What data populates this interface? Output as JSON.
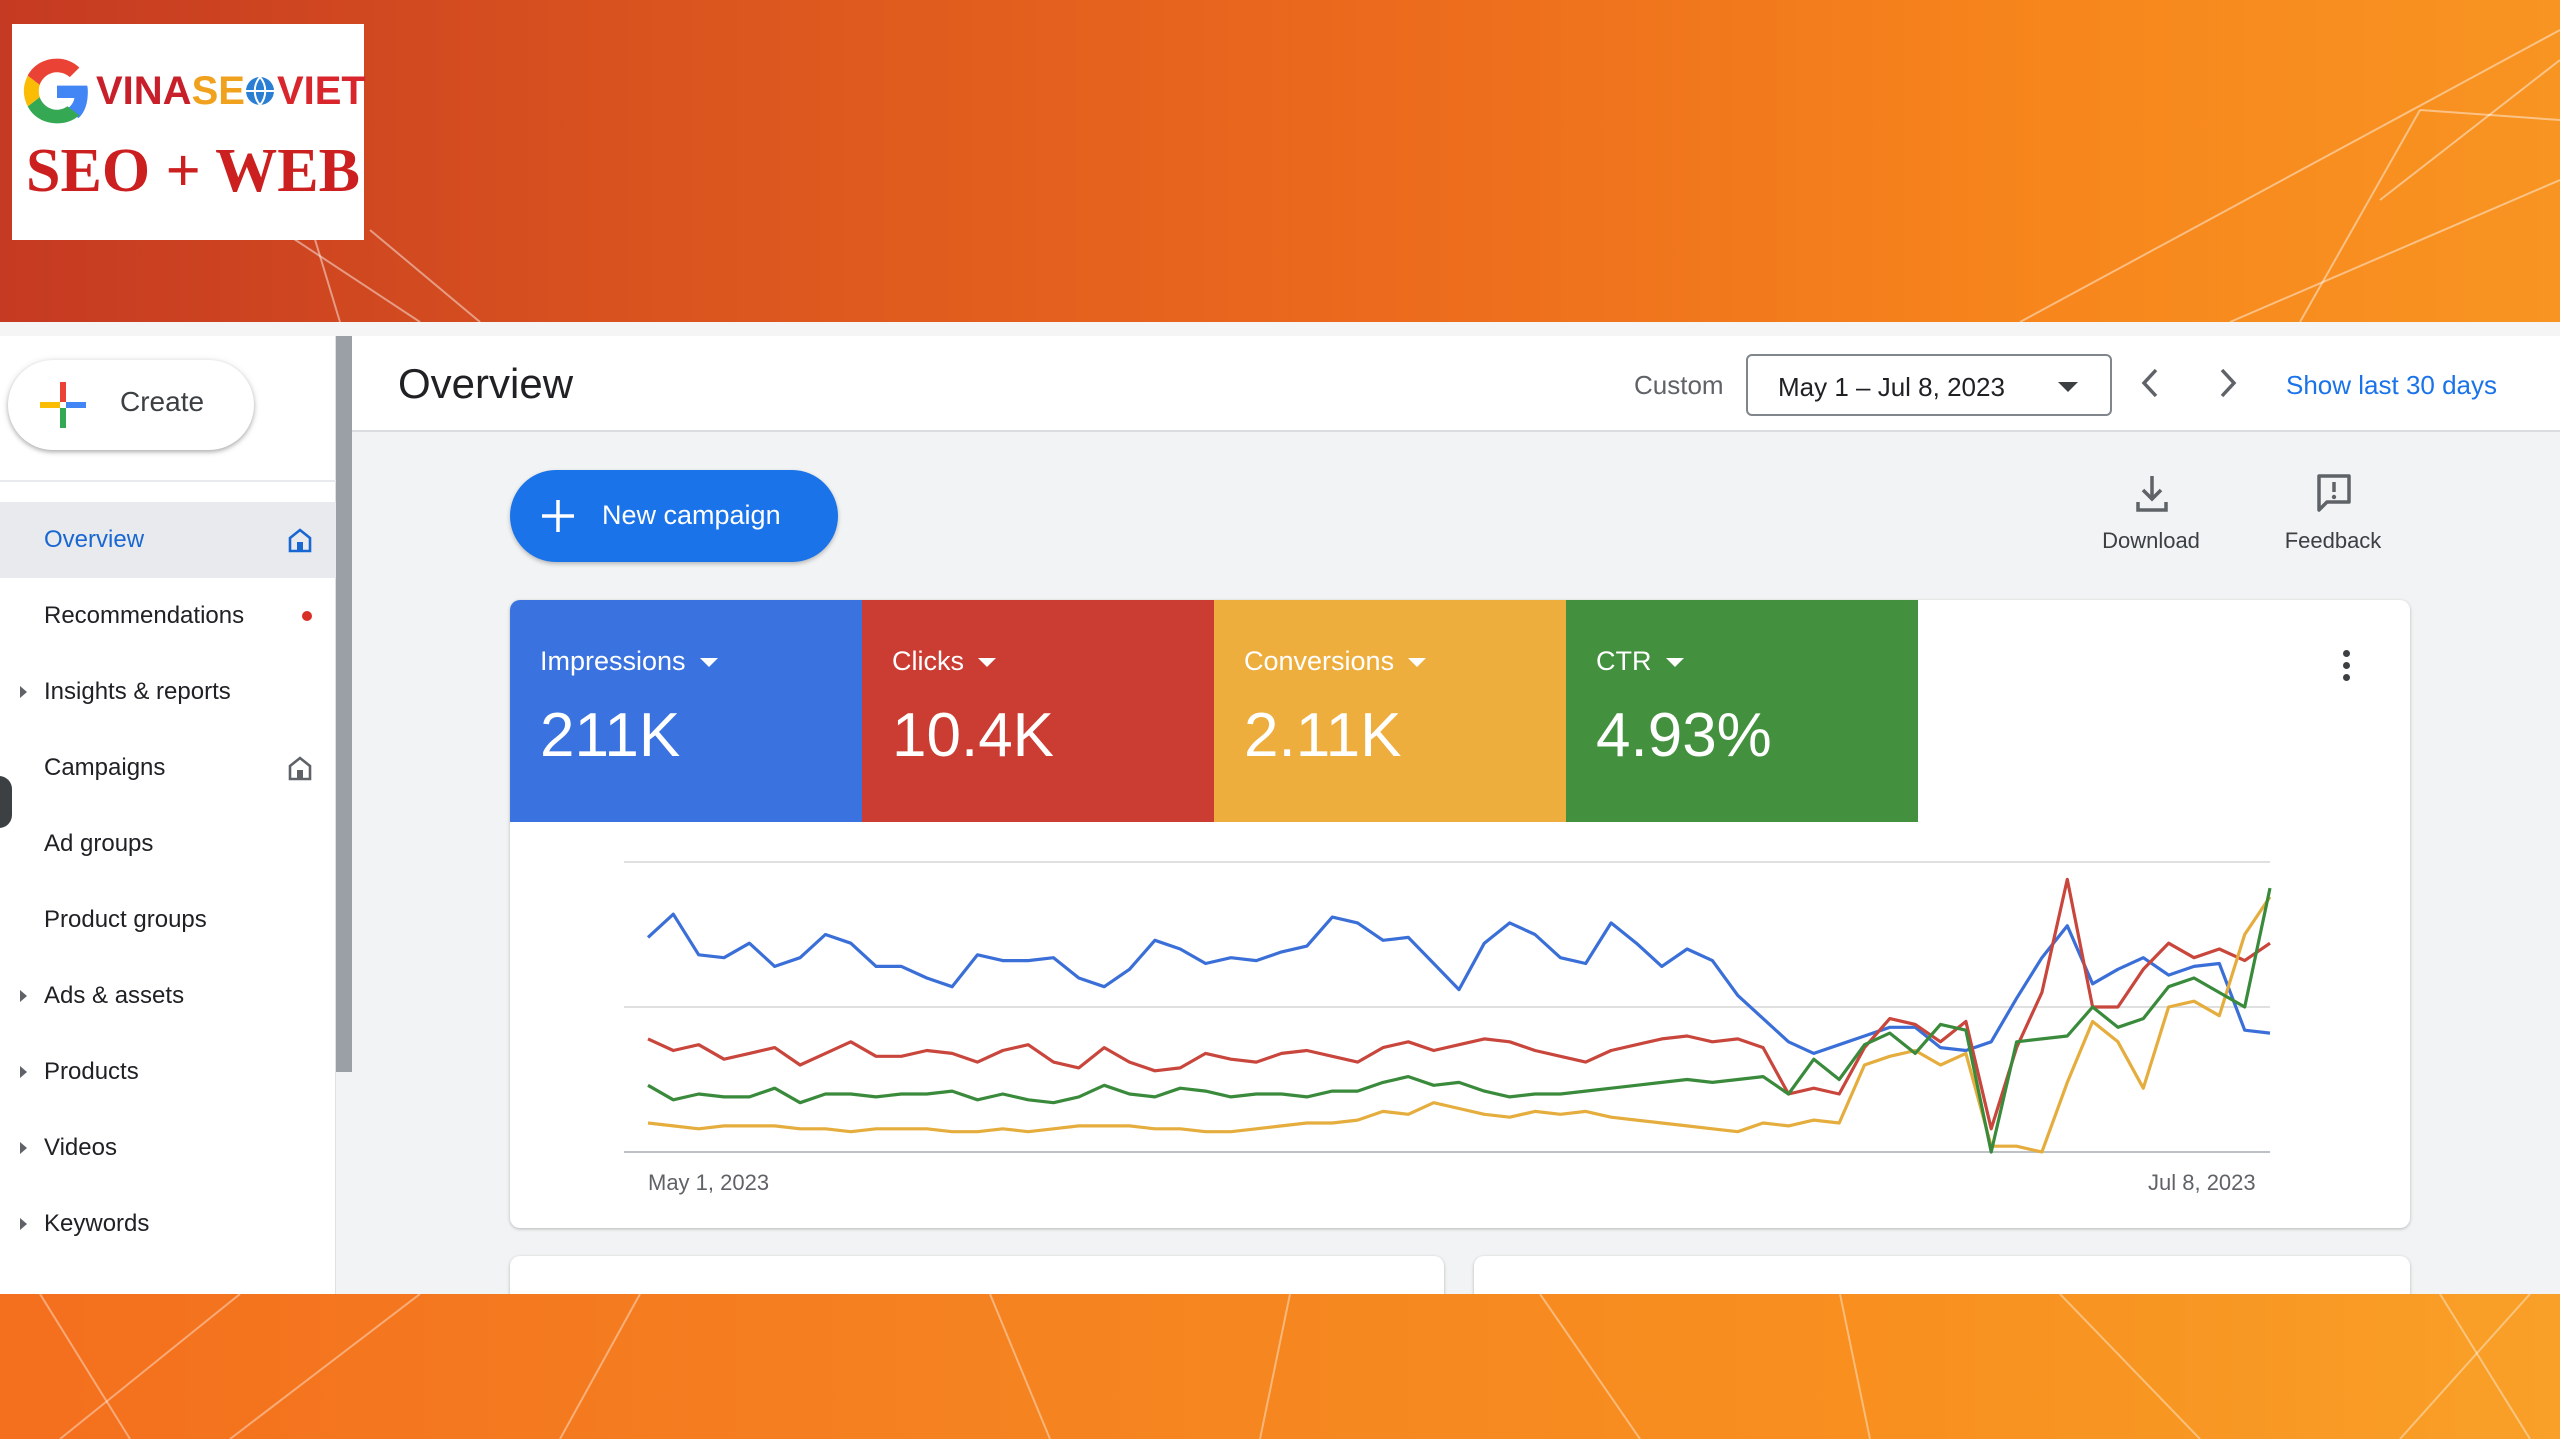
{
  "logo": {
    "brand_parts": [
      "VINA",
      "SE",
      "VIET"
    ],
    "tagline": "SEO + WEB",
    "colors": {
      "red": "#c8202a",
      "gold": "#f0a21e"
    }
  },
  "sidebar": {
    "create_label": "Create",
    "items": [
      {
        "label": "Overview",
        "active": true,
        "icon": "home-icon"
      },
      {
        "label": "Recommendations",
        "badge": "red-dot"
      },
      {
        "label": "Insights & reports",
        "expandable": true
      },
      {
        "label": "Campaigns",
        "icon": "home-icon"
      },
      {
        "label": "Ad groups"
      },
      {
        "label": "Product groups"
      },
      {
        "label": "Ads & assets",
        "expandable": true
      },
      {
        "label": "Products",
        "expandable": true
      },
      {
        "label": "Videos",
        "expandable": true
      },
      {
        "label": "Keywords",
        "expandable": true
      }
    ]
  },
  "header": {
    "title": "Overview",
    "range_mode": "Custom",
    "date_range": "May 1 – Jul 8, 2023",
    "show_last": "Show last 30 days"
  },
  "toolbar": {
    "new_campaign": "New campaign",
    "download": "Download",
    "feedback": "Feedback"
  },
  "metrics": [
    {
      "name": "Impressions",
      "value": "211K",
      "color": "#3a72df"
    },
    {
      "name": "Clicks",
      "value": "10.4K",
      "color": "#cb3c32"
    },
    {
      "name": "Conversions",
      "value": "2.11K",
      "color": "#eeae3d"
    },
    {
      "name": "CTR",
      "value": "4.93%",
      "color": "#43903f"
    }
  ],
  "chart_data": {
    "type": "line",
    "x_start_label": "May 1, 2023",
    "x_end_label": "Jul 8, 2023",
    "ylim": [
      0,
      100
    ],
    "grid": true,
    "series": [
      {
        "name": "Impressions",
        "color": "#3b6fd8",
        "values": [
          74,
          82,
          68,
          67,
          72,
          64,
          67,
          75,
          72,
          64,
          64,
          60,
          57,
          68,
          66,
          66,
          67,
          60,
          57,
          63,
          73,
          70,
          65,
          67,
          66,
          69,
          71,
          81,
          79,
          73,
          74,
          65,
          56,
          72,
          79,
          75,
          67,
          65,
          79,
          72,
          64,
          70,
          66,
          54,
          46,
          38,
          34,
          37,
          40,
          43,
          43,
          36,
          35,
          38,
          53,
          67,
          78,
          58,
          63,
          67,
          61,
          64,
          65,
          42,
          41
        ]
      },
      {
        "name": "Clicks",
        "color": "#c9463d",
        "values": [
          39,
          35,
          37,
          32,
          34,
          36,
          30,
          34,
          38,
          33,
          33,
          35,
          34,
          31,
          35,
          37,
          31,
          29,
          36,
          31,
          28,
          29,
          34,
          32,
          31,
          34,
          35,
          33,
          31,
          36,
          38,
          35,
          37,
          39,
          38,
          35,
          33,
          31,
          35,
          37,
          39,
          40,
          38,
          39,
          36,
          20,
          22,
          20,
          36,
          46,
          44,
          38,
          45,
          8,
          36,
          55,
          94,
          50,
          50,
          63,
          72,
          67,
          70,
          66,
          72
        ]
      },
      {
        "name": "Conversions",
        "color": "#e5ad3d",
        "values": [
          10,
          9,
          8,
          9,
          9,
          9,
          8,
          8,
          7,
          8,
          8,
          8,
          7,
          7,
          8,
          7,
          8,
          9,
          9,
          9,
          8,
          8,
          7,
          7,
          8,
          9,
          10,
          10,
          11,
          14,
          13,
          17,
          15,
          13,
          12,
          14,
          13,
          14,
          12,
          11,
          10,
          9,
          8,
          7,
          10,
          9,
          11,
          10,
          30,
          33,
          35,
          30,
          34,
          2,
          2,
          0,
          24,
          45,
          38,
          22,
          50,
          52,
          47,
          75,
          88
        ]
      },
      {
        "name": "CTR",
        "color": "#3a8a3c",
        "values": [
          23,
          18,
          20,
          19,
          19,
          22,
          17,
          20,
          20,
          19,
          20,
          20,
          21,
          18,
          20,
          18,
          17,
          19,
          23,
          20,
          19,
          22,
          21,
          19,
          20,
          20,
          19,
          21,
          21,
          24,
          26,
          23,
          24,
          21,
          19,
          20,
          20,
          21,
          22,
          23,
          24,
          25,
          24,
          25,
          26,
          20,
          32,
          25,
          37,
          41,
          34,
          44,
          42,
          0,
          38,
          39,
          40,
          50,
          43,
          46,
          57,
          60,
          55,
          50,
          91
        ]
      }
    ]
  }
}
